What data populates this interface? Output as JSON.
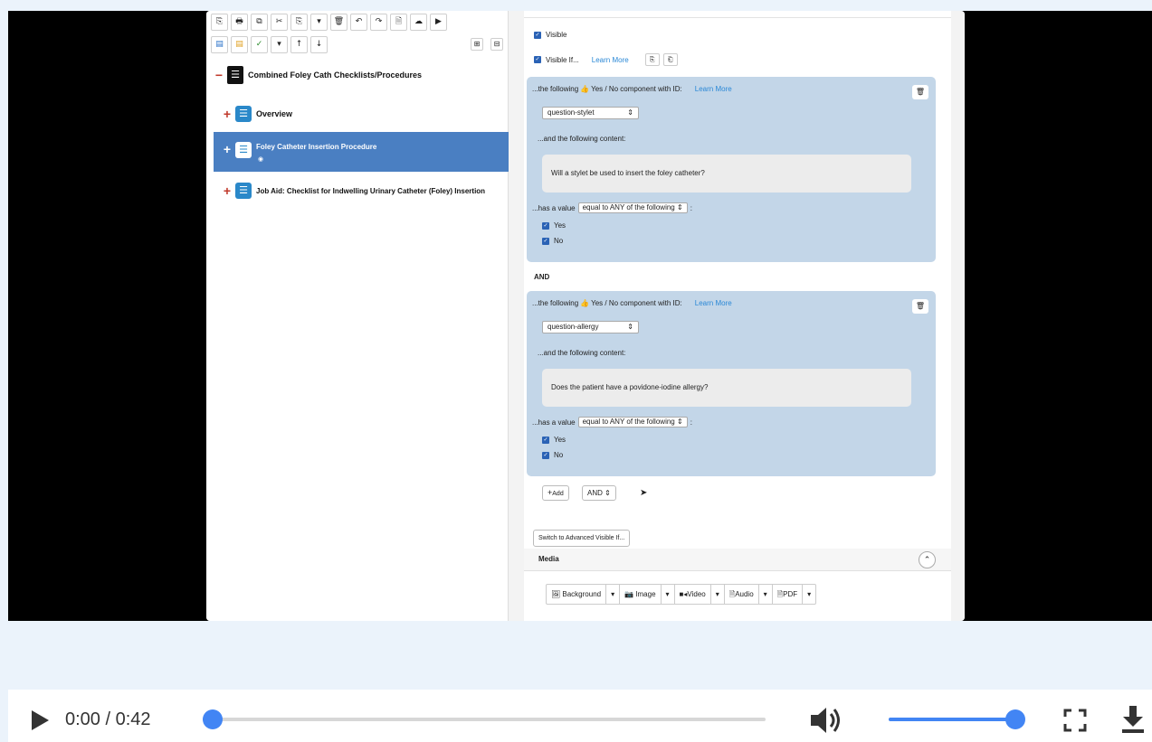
{
  "toolbar_row1": [
    "⎘",
    "🖶",
    "⧉",
    "✂",
    "⎘",
    "▾",
    "🗑",
    "↶",
    "↷",
    "🗎",
    "☁",
    "▶"
  ],
  "toolbar_row2": [
    "▤",
    "▤",
    "✓",
    "▾",
    "↑",
    "↓"
  ],
  "tree": {
    "root_label": "Combined Foley Cath Checklists/Procedures",
    "items": [
      {
        "label": "Overview"
      },
      {
        "label": "Foley Catheter Insertion Procedure",
        "selected": true
      },
      {
        "label": "Job Aid: Checklist for Indwelling Urinary Catheter (Foley) Insertion"
      }
    ]
  },
  "form": {
    "visible_label": "Visible",
    "visible_if_label": "Visible If...",
    "learn_more": "Learn More",
    "conditions": [
      {
        "intro_prefix": "...the following",
        "intro_suffix": "Yes / No component with ID:",
        "learn_more": "Learn More",
        "component_id": "question-stylet",
        "content_label": "...and the following content:",
        "content_text": "Will a stylet be used to insert the foley catheter?",
        "has_value_label": "...has a value",
        "value_select": "equal to ANY of the following",
        "options": [
          "Yes",
          "No"
        ]
      },
      {
        "intro_prefix": "...the following",
        "intro_suffix": "Yes / No component with ID:",
        "learn_more": "Learn More",
        "component_id": "question-allergy",
        "content_label": "...and the following content:",
        "content_text": "Does the patient have a povidone-iodine allergy?",
        "has_value_label": "...has a value",
        "value_select": "equal to ANY of the following",
        "options": [
          "Yes",
          "No"
        ]
      }
    ],
    "and_label": "AND",
    "add_button": "Add",
    "and_select": "AND",
    "switch_button": "Switch to Advanced Visible If...",
    "media_label": "Media",
    "media_buttons": [
      "Background",
      "Image",
      "Video",
      "Audio",
      "PDF"
    ]
  },
  "player": {
    "time": "0:00 / 0:42",
    "progress": 0.0,
    "volume": 1.0
  },
  "colors": {
    "accent": "#4285f4",
    "selection": "#4a7fc2",
    "card": "#c3d6e8"
  }
}
